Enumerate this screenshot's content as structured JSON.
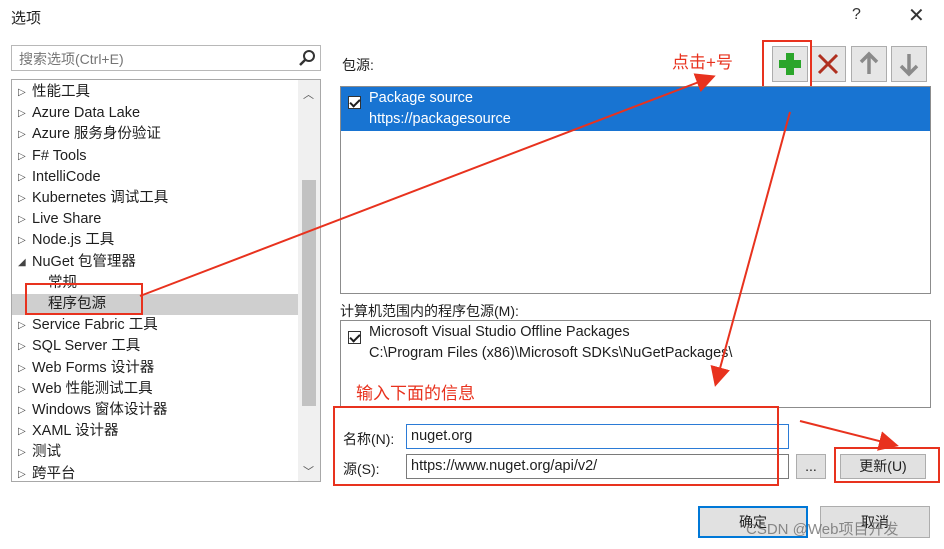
{
  "dialog": {
    "title": "选项",
    "help": "?",
    "close": "✕"
  },
  "search": {
    "placeholder": "搜索选项(Ctrl+E)"
  },
  "tree": [
    {
      "label": "性能工具",
      "arrow": "▷",
      "child": false,
      "selected": false
    },
    {
      "label": "Azure Data Lake",
      "arrow": "▷",
      "child": false,
      "selected": false
    },
    {
      "label": "Azure 服务身份验证",
      "arrow": "▷",
      "child": false,
      "selected": false
    },
    {
      "label": "F# Tools",
      "arrow": "▷",
      "child": false,
      "selected": false
    },
    {
      "label": "IntelliCode",
      "arrow": "▷",
      "child": false,
      "selected": false
    },
    {
      "label": "Kubernetes 调试工具",
      "arrow": "▷",
      "child": false,
      "selected": false
    },
    {
      "label": "Live Share",
      "arrow": "▷",
      "child": false,
      "selected": false
    },
    {
      "label": "Node.js 工具",
      "arrow": "▷",
      "child": false,
      "selected": false
    },
    {
      "label": "NuGet 包管理器",
      "arrow": "◢",
      "child": false,
      "selected": false
    },
    {
      "label": "常规",
      "arrow": "",
      "child": true,
      "selected": false
    },
    {
      "label": "程序包源",
      "arrow": "",
      "child": true,
      "selected": true
    },
    {
      "label": "Service Fabric 工具",
      "arrow": "▷",
      "child": false,
      "selected": false
    },
    {
      "label": "SQL Server 工具",
      "arrow": "▷",
      "child": false,
      "selected": false
    },
    {
      "label": "Web Forms 设计器",
      "arrow": "▷",
      "child": false,
      "selected": false
    },
    {
      "label": "Web 性能测试工具",
      "arrow": "▷",
      "child": false,
      "selected": false
    },
    {
      "label": "Windows 窗体设计器",
      "arrow": "▷",
      "child": false,
      "selected": false
    },
    {
      "label": "XAML 设计器",
      "arrow": "▷",
      "child": false,
      "selected": false
    },
    {
      "label": "测试",
      "arrow": "▷",
      "child": false,
      "selected": false
    },
    {
      "label": "跨平台",
      "arrow": "▷",
      "child": false,
      "selected": false
    }
  ],
  "package_sources": {
    "label": "包源:",
    "items": [
      {
        "name": "Package source",
        "url": "https://packagesource",
        "checked": true
      }
    ]
  },
  "machine_sources": {
    "label": "计算机范围内的程序包源(M):",
    "items": [
      {
        "name": "Microsoft Visual Studio Offline Packages",
        "path": "C:\\Program Files (x86)\\Microsoft SDKs\\NuGetPackages\\",
        "checked": true
      }
    ]
  },
  "form": {
    "name_label": "名称(N):",
    "name_value": "nuget.org",
    "source_label": "源(S):",
    "source_value": "https://www.nuget.org/api/v2/",
    "browse_label": "...",
    "update_label": "更新(U)"
  },
  "buttons": {
    "ok": "确定",
    "cancel": "取消"
  },
  "annotations": {
    "click_plus": "点击+号",
    "enter_info": "输入下面的信息",
    "color": "#e8321e"
  },
  "watermark": "CSDN @Web项目开发",
  "colors": {
    "selection": "#1874d2",
    "add_icon": "#2aa52a",
    "remove_icon": "#c0392b"
  }
}
